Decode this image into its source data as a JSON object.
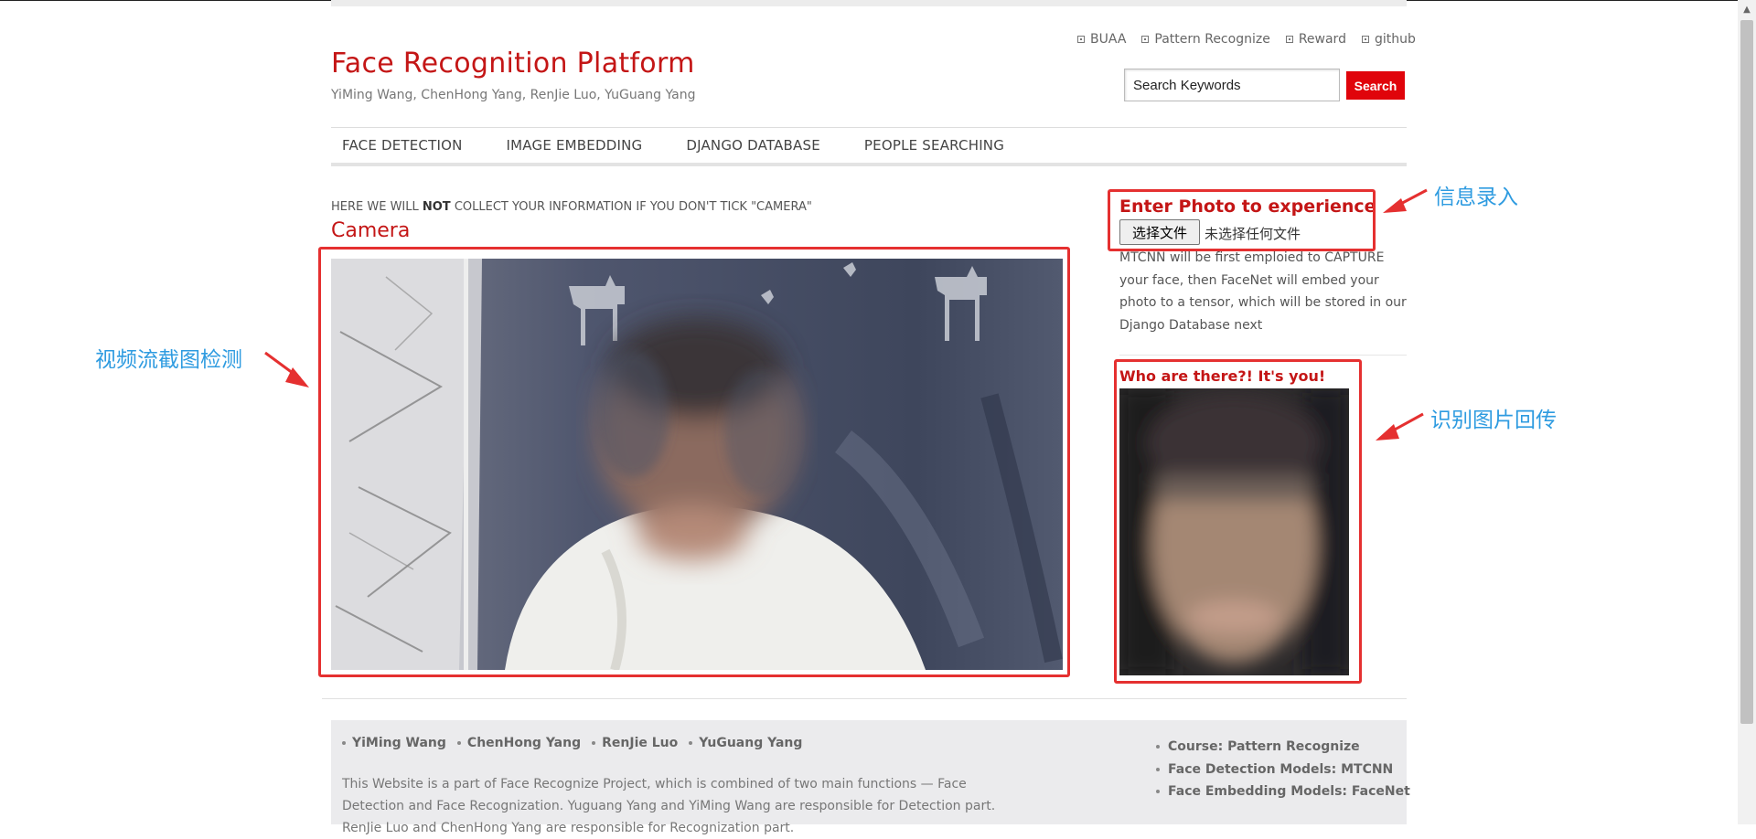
{
  "header": {
    "title": "Face Recognition Platform",
    "subtitle": "YiMing Wang, ChenHong Yang, RenJie Luo, YuGuang Yang",
    "top_links": [
      "BUAA",
      "Pattern Recognize",
      "Reward",
      "github"
    ],
    "search": {
      "value": "Search Keywords",
      "button": "Search"
    }
  },
  "nav": {
    "items": [
      "FACE DETECTION",
      "IMAGE EMBEDDING",
      "DJANGO DATABASE",
      "PEOPLE SEARCHING"
    ]
  },
  "main": {
    "notice_before": "HERE WE WILL ",
    "notice_bold": "NOT",
    "notice_after": " COLLECT YOUR INFORMATION IF YOU DON'T TICK \"CAMERA\"",
    "camera_title": "Camera"
  },
  "sidebar": {
    "enter_title": "Enter Photo to experience",
    "file_button": "选择文件",
    "file_status": "未选择任何文件",
    "description": "MTCNN will be first emploied to CAPTURE your face, then FaceNet will embed your photo to a tensor, which will be stored in our Django Database next",
    "who_title": "Who are there?! It's you!"
  },
  "annotations": {
    "video_label": "视频流截图检测",
    "enter_label": "信息录入",
    "result_label": "识别图片回传",
    "color": "#2e9be0",
    "box_color": "#e53030"
  },
  "footer": {
    "names": [
      "YiMing Wang",
      "ChenHong Yang",
      "RenJie Luo",
      "YuGuang Yang"
    ],
    "text": "This Website is a part of Face Recognize Project, which is combined of two main functions — Face Detection and Face Recognization. Yuguang Yang and YiMing Wang are responsible for Detection part. RenJie Luo and ChenHong Yang are responsible for Recognization part.",
    "right_items": [
      "Course: Pattern Recognize",
      "Face Detection Models: MTCNN",
      "Face Embedding Models: FaceNet"
    ]
  },
  "colors": {
    "brand_red": "#c41616",
    "search_red": "#e0040b"
  }
}
